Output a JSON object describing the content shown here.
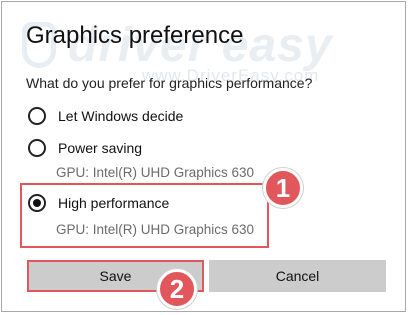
{
  "dialog": {
    "title": "Graphics preference",
    "question": "What do you prefer for graphics performance?"
  },
  "watermark": {
    "brand": "driver easy",
    "url": "www.DriverEasy.com"
  },
  "options": [
    {
      "label": "Let Windows decide",
      "selected": false
    },
    {
      "label": "Power saving",
      "selected": false,
      "gpu": "GPU: Intel(R) UHD Graphics 630"
    },
    {
      "label": "High performance",
      "selected": true,
      "gpu": "GPU: Intel(R) UHD Graphics 630"
    }
  ],
  "badges": {
    "step1": "1",
    "step2": "2"
  },
  "buttons": {
    "save": "Save",
    "cancel": "Cancel"
  },
  "colors": {
    "highlight": "#e2575b",
    "button_bg": "#cccccc",
    "secondary_text": "#6b6b6b",
    "watermark": "#e9eef3"
  }
}
